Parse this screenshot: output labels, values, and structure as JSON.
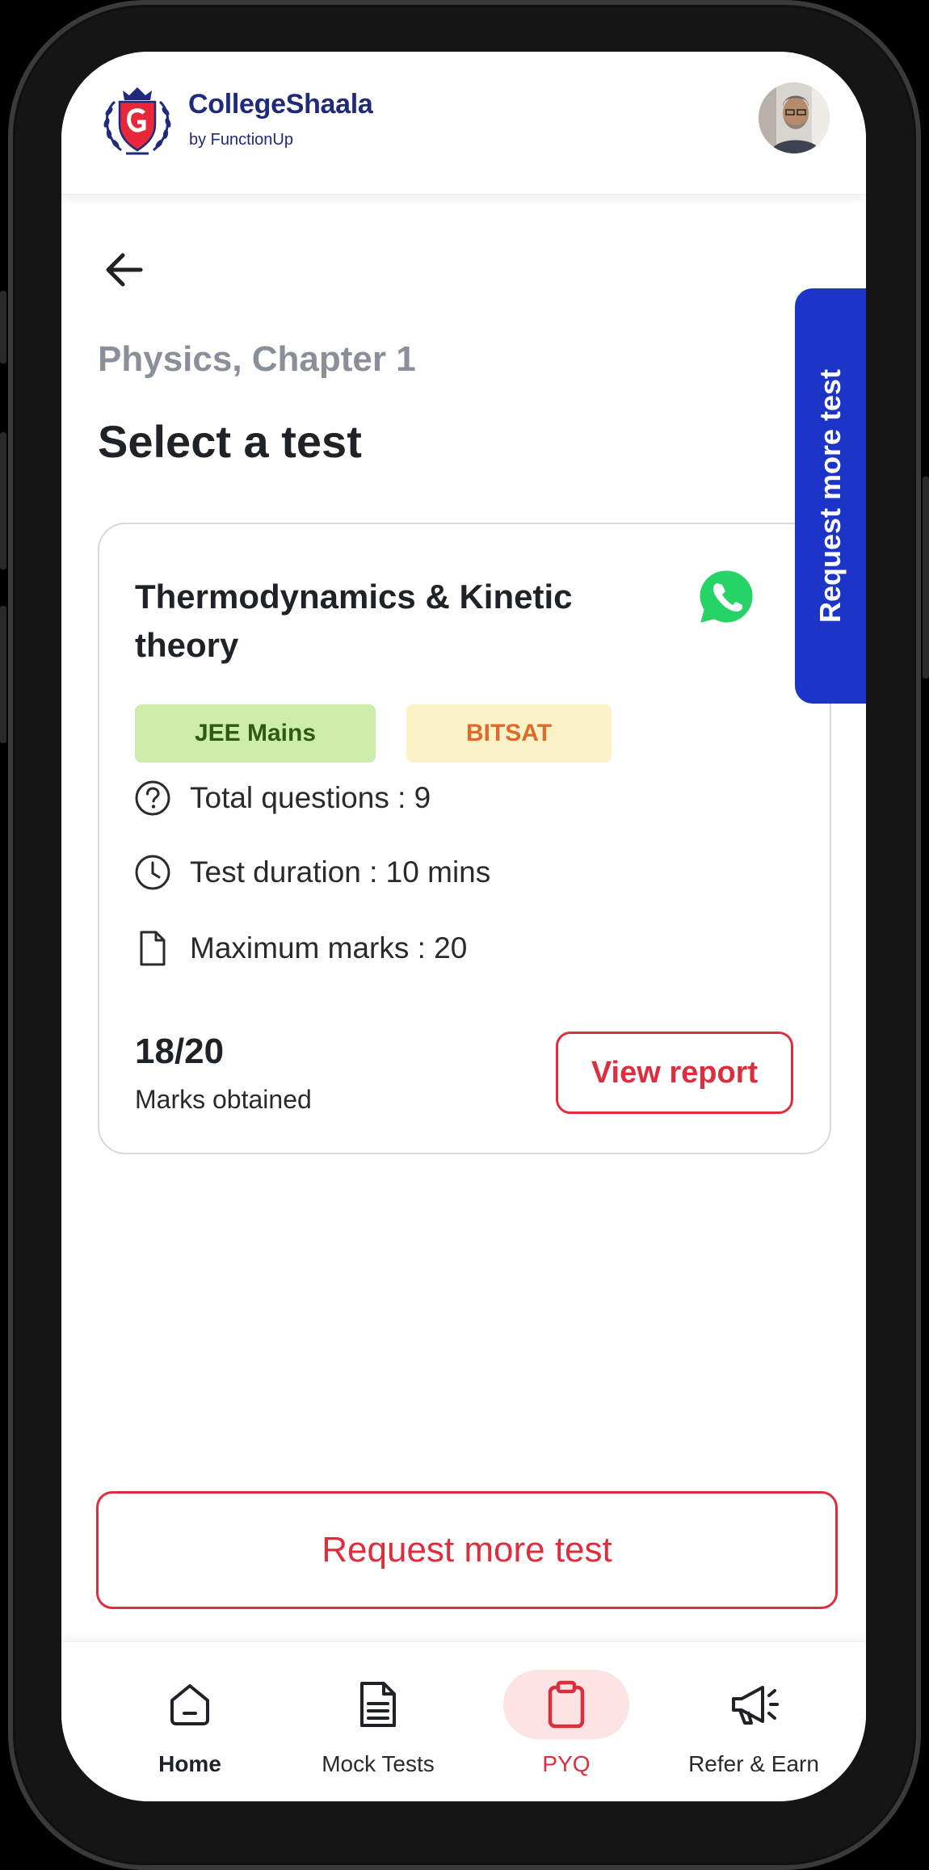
{
  "header": {
    "brand_name": "CollegeShaala",
    "brand_sub": "by FunctionUp"
  },
  "breadcrumb": "Physics, Chapter 1",
  "page_title": "Select a test",
  "side_tab_label": "Request more test",
  "test_card": {
    "title": "Thermodynamics & Kinetic theory",
    "tags": [
      "JEE Mains",
      "BITSAT"
    ],
    "info": {
      "questions": "Total questions : 9",
      "duration": "Test duration : 10 mins",
      "marks": "Maximum marks : 20"
    },
    "score": "18/20",
    "score_label": "Marks obtained",
    "view_report": "View report"
  },
  "request_button": "Request more test",
  "nav": {
    "items": [
      {
        "label": "Home",
        "icon": "home-icon"
      },
      {
        "label": "Mock Tests",
        "icon": "document-icon"
      },
      {
        "label": "PYQ",
        "icon": "clipboard-icon"
      },
      {
        "label": "Refer & Earn",
        "icon": "megaphone-icon"
      }
    ],
    "active": "PYQ"
  },
  "colors": {
    "brand_blue": "#1f2a7a",
    "accent_red": "#de2e3d",
    "side_tab_blue": "#1d34c9",
    "jee_tag_bg": "#cdeeaa",
    "bitsat_tag_bg": "#fbf2c8",
    "whatsapp_green": "#25d366"
  }
}
